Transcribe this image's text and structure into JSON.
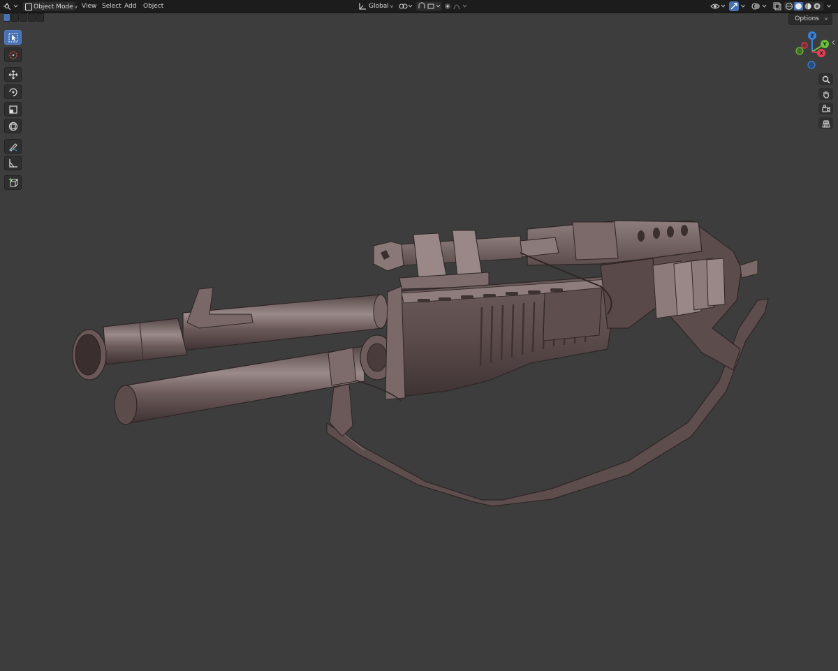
{
  "header": {
    "mode_label": "Object Mode",
    "menus": [
      "View",
      "Select",
      "Add",
      "Object"
    ],
    "orientation_label": "Global"
  },
  "overlay": {
    "options_label": "Options"
  },
  "gizmo": {
    "z_label": "Z",
    "y_label": "Y",
    "x_label": "X"
  },
  "toolbar": {
    "tools": [
      "select-box",
      "cursor",
      "move",
      "rotate",
      "scale",
      "transform",
      "annotate",
      "measure",
      "add-cube"
    ],
    "active_tool": "select-box"
  },
  "colors": {
    "header_bg": "#1c1c1c",
    "viewport_bg": "#3d3d3d",
    "active_blue": "#4772b3",
    "model_base": "#6b5858",
    "axis_x": "#e63e55",
    "axis_y": "#6bbf3a",
    "axis_z": "#3d83d9"
  }
}
